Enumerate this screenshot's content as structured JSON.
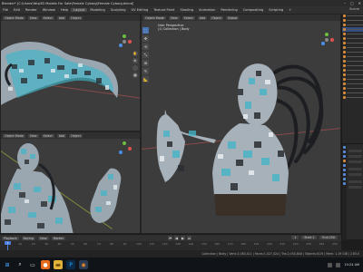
{
  "window": {
    "title": "Blender* [C:\\Users\\Yatp3D Models For Sale\\Female Cyborg\\Female Cyborg.blend]",
    "controls": [
      "–",
      "▢",
      "✕"
    ]
  },
  "menubar": {
    "items": [
      "File",
      "Edit",
      "Render",
      "Window",
      "Help",
      "Layout",
      "Modeling",
      "Sculpting",
      "UV Editing",
      "Texture Paint",
      "Shading",
      "Animation",
      "Rendering",
      "Compositing",
      "Scripting",
      "+"
    ],
    "active_index": 5,
    "right_label": "Scene"
  },
  "viewports": {
    "top_left": {
      "header": [
        "Object Mode",
        "View",
        "Select",
        "Add",
        "Object"
      ],
      "label": ""
    },
    "bottom_left": {
      "header": [
        "Object Mode",
        "View",
        "Select",
        "Add",
        "Object"
      ],
      "label": ""
    },
    "main": {
      "header": [
        "Object Mode",
        "View",
        "Select",
        "Add",
        "Object",
        "Global"
      ],
      "label_line1": "User Perspective",
      "label_line2": "(1) Collection | Body"
    }
  },
  "tools": [
    "⬚",
    "✥",
    "⟲",
    "⤡",
    "⊞",
    "✎",
    "📐",
    "⬚"
  ],
  "nav_buttons": [
    "✋",
    "⊕",
    "🎥",
    "▦"
  ],
  "timeline": {
    "header": [
      "Playback",
      "Keying",
      "View",
      "Marker"
    ],
    "play_buttons": [
      "⏮",
      "◀",
      "▶",
      "⏭"
    ],
    "frame_fields": [
      "1",
      "Start 1",
      "End 250"
    ],
    "ruler_ticks": [
      "0",
      "10",
      "20",
      "30",
      "40",
      "50",
      "60",
      "70",
      "80",
      "90",
      "100",
      "110",
      "120",
      "130",
      "140",
      "150",
      "160",
      "170",
      "180",
      "190",
      "200",
      "210",
      "220",
      "230",
      "240",
      "250"
    ],
    "current_frame": "1"
  },
  "statusbar": {
    "text": "Collection | Body | Verts:1,083,411 | Faces:1,027,424 | Tris:2,054,848 | Objects:0/19 | Mem: 1.19 GiB | 2.83.0"
  },
  "taskbar": {
    "clock": "10:24 AM"
  },
  "colors": {
    "viewport_bg": "#3c3c3c",
    "accent_blue": "#4772b3",
    "mesh_cyan": "#3fb6c9",
    "mesh_dark": "#2b2e33",
    "mesh_light": "#c9d3da"
  }
}
